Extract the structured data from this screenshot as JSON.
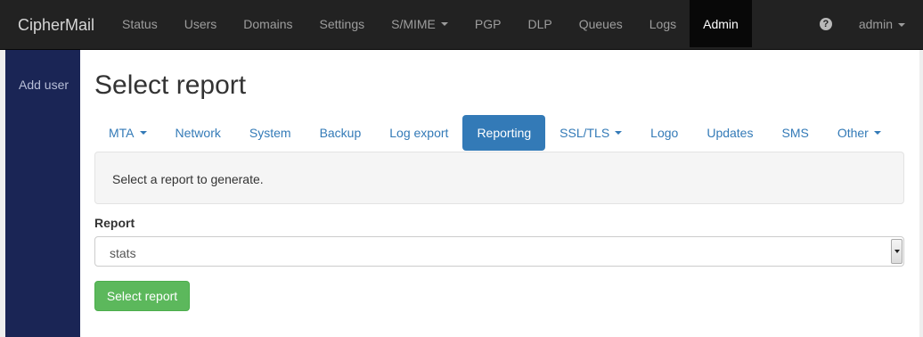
{
  "navbar": {
    "brand": "CipherMail",
    "items": [
      {
        "label": "Status",
        "dropdown": false,
        "active": false
      },
      {
        "label": "Users",
        "dropdown": false,
        "active": false
      },
      {
        "label": "Domains",
        "dropdown": false,
        "active": false
      },
      {
        "label": "Settings",
        "dropdown": false,
        "active": false
      },
      {
        "label": "S/MIME",
        "dropdown": true,
        "active": false
      },
      {
        "label": "PGP",
        "dropdown": false,
        "active": false
      },
      {
        "label": "DLP",
        "dropdown": false,
        "active": false
      },
      {
        "label": "Queues",
        "dropdown": false,
        "active": false
      },
      {
        "label": "Logs",
        "dropdown": false,
        "active": false
      },
      {
        "label": "Admin",
        "dropdown": false,
        "active": true
      }
    ],
    "help_icon": "question-circle-icon",
    "user": "admin"
  },
  "sidebar": {
    "add_user": "Add user"
  },
  "main": {
    "title": "Select report",
    "tabs": [
      {
        "label": "MTA",
        "dropdown": true,
        "active": false
      },
      {
        "label": "Network",
        "dropdown": false,
        "active": false
      },
      {
        "label": "System",
        "dropdown": false,
        "active": false
      },
      {
        "label": "Backup",
        "dropdown": false,
        "active": false
      },
      {
        "label": "Log export",
        "dropdown": false,
        "active": false
      },
      {
        "label": "Reporting",
        "dropdown": false,
        "active": true
      },
      {
        "label": "SSL/TLS",
        "dropdown": true,
        "active": false
      },
      {
        "label": "Logo",
        "dropdown": false,
        "active": false
      },
      {
        "label": "Updates",
        "dropdown": false,
        "active": false
      },
      {
        "label": "SMS",
        "dropdown": false,
        "active": false
      },
      {
        "label": "Other",
        "dropdown": true,
        "active": false
      }
    ],
    "info_text": "Select a report to generate.",
    "report_label": "Report",
    "report_value": "stats",
    "submit_label": "Select report"
  },
  "colors": {
    "navbar_bg": "#222222",
    "sidebar_bg": "#1a2555",
    "tab_active": "#337ab7",
    "submit_button": "#5cb85c"
  }
}
